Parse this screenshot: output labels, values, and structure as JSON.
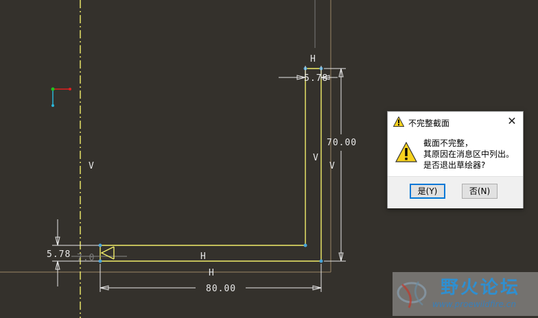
{
  "canvas": {
    "dim_horizontal_bottom": "80.00",
    "dim_vertical_right": "70.00",
    "dim_thickness_left": "5.78",
    "dim_thickness_top": "5.78",
    "dim_partial_hidden": "7.0",
    "constraint_h": "H",
    "constraint_v": "V"
  },
  "dialog": {
    "title": "不完整截面",
    "close_label": "✕",
    "message_lines": [
      "截面不完整，",
      "其原因在消息区中列出。",
      "是否退出草绘器?"
    ],
    "yes_label": "是(Y)",
    "no_label": "否(N)"
  },
  "watermark": {
    "brand": "野火论坛",
    "url": "www.proewildfire.cn"
  },
  "colors": {
    "background": "#34312c",
    "sketch_yellow": "#f2ee6a",
    "dimension_white": "#e8e8e8",
    "vertex_blue": "#4aa4d8",
    "reference_tan": "#a08a6a"
  }
}
